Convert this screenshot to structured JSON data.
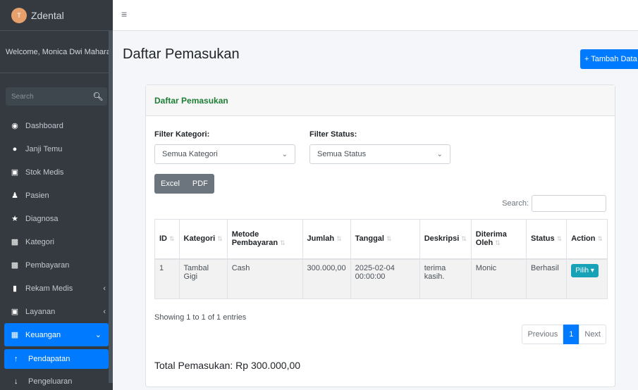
{
  "sidebar": {
    "brand_logo": "T",
    "brand": "Zdental",
    "welcome": "Welcome, Monica Dwi Mahara",
    "search_placeholder": "Search",
    "items": [
      {
        "label": "Dashboard",
        "icon": "palette-icon"
      },
      {
        "label": "Janji Temu",
        "icon": "comment-icon"
      },
      {
        "label": "Stok Medis",
        "icon": "medkit-icon"
      },
      {
        "label": "Pasien",
        "icon": "user-icon"
      },
      {
        "label": "Diagnosa",
        "icon": "diagnoses-icon"
      },
      {
        "label": "Kategori",
        "icon": "list-icon"
      },
      {
        "label": "Pembayaran",
        "icon": "file-invoice-icon"
      },
      {
        "label": "Rekam Medis",
        "icon": "file-medical-icon"
      },
      {
        "label": "Layanan",
        "icon": "briefcase-medical-icon"
      },
      {
        "label": "Keuangan",
        "icon": "money-icon"
      },
      {
        "label": "Pendapatan",
        "icon": "arrow-up-icon"
      },
      {
        "label": "Pengeluaran",
        "icon": "arrow-down-icon"
      }
    ]
  },
  "header": {
    "title": "Daftar Pemasukan",
    "add_button": "+ Tambah Data"
  },
  "card": {
    "title": "Daftar Pemasukan",
    "filter_kategori_label": "Filter Kategori:",
    "filter_kategori_value": "Semua Kategori",
    "filter_status_label": "Filter Status:",
    "filter_status_value": "Semua Status",
    "export": [
      "Excel",
      "PDF"
    ],
    "search_label": "Search:",
    "columns": [
      "ID",
      "Kategori",
      "Metode Pembayaran",
      "Jumlah",
      "Tanggal",
      "Deskripsi",
      "Diterima Oleh",
      "Status",
      "Action"
    ],
    "rows": [
      {
        "id": "1",
        "kategori": "Tambal Gigi",
        "metode": "Cash",
        "jumlah": "300.000,00",
        "tanggal": "2025-02-04 00:00:00",
        "deskripsi": "terima kasih.",
        "diterima": "Monic",
        "status": "Berhasil",
        "action": "Pilih"
      }
    ],
    "info": "Showing 1 to 1 of 1 entries",
    "pagination": {
      "prev": "Previous",
      "current": "1",
      "next": "Next"
    },
    "total": "Total Pemasukan: Rp 300.000,00"
  },
  "colors": {
    "primary": "#007bff",
    "sidebar": "#343a40",
    "title_green": "#1e7e34",
    "info": "#17a2b8"
  }
}
